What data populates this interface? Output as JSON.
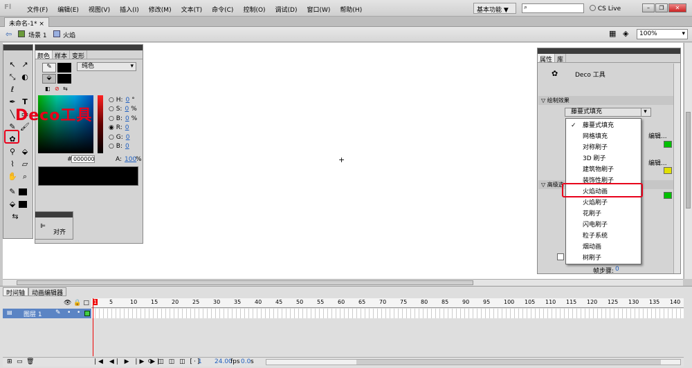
{
  "app": {
    "logo": "Fl"
  },
  "menu": [
    "文件(F)",
    "编辑(E)",
    "视图(V)",
    "插入(I)",
    "修改(M)",
    "文本(T)",
    "命令(C)",
    "控制(O)",
    "调试(D)",
    "窗口(W)",
    "帮助(H)"
  ],
  "workspace": {
    "label": "基本功能",
    "arrow": "▼"
  },
  "search": {
    "placeholder": ""
  },
  "cslive": "CS Live",
  "doc_tab": "未命名-1*",
  "breadcrumb": {
    "scene": "场景 1",
    "symbol": "火焰"
  },
  "zoom": "100%",
  "annotation": "Deco工具",
  "color_panel": {
    "tabs": [
      "颜色",
      "样本",
      "变形"
    ],
    "fill_type": "纯色",
    "fields": [
      {
        "label": "H:",
        "value": "0",
        "unit": "°"
      },
      {
        "label": "S:",
        "value": "0",
        "unit": "%"
      },
      {
        "label": "B:",
        "value": "0",
        "unit": "%"
      },
      {
        "label": "R:",
        "value": "0",
        "unit": ""
      },
      {
        "label": "G:",
        "value": "0",
        "unit": ""
      },
      {
        "label": "B:",
        "value": "0",
        "unit": ""
      }
    ],
    "alpha_label": "A:",
    "alpha_value": "100",
    "alpha_unit": "%",
    "hex_prefix": "#",
    "hex": "000000"
  },
  "align_panel": {
    "label": "对齐"
  },
  "properties": {
    "tabs": [
      "属性",
      "库"
    ],
    "tool_name": "Deco 工具",
    "section_draw": "绘制效果",
    "dropdown_value": "藤蔓式填充",
    "section_adv": "高级选",
    "edit1": "编辑...",
    "edit2": "编辑...",
    "frame_step_label": "帧步骤:",
    "frame_step_value": "0"
  },
  "effect_menu": {
    "items": [
      "藤蔓式填充",
      "网格填充",
      "对称刷子",
      "3D 刷子",
      "建筑物刷子",
      "装饰性刷子",
      "火焰动画",
      "火焰刷子",
      "花刷子",
      "闪电刷子",
      "粒子系统",
      "烟动画",
      "树刷子"
    ],
    "checked_index": 0,
    "highlighted_index": 6
  },
  "timeline": {
    "tabs": [
      "时间轴",
      "动画编辑器"
    ],
    "layer": "图层 1",
    "ruler": [
      "1",
      "5",
      "10",
      "15",
      "20",
      "25",
      "30",
      "35",
      "40",
      "45",
      "50",
      "55",
      "60",
      "65",
      "70",
      "75",
      "80",
      "85",
      "90",
      "95",
      "100",
      "105",
      "110",
      "115",
      "120",
      "125",
      "130",
      "135",
      "140"
    ],
    "current_frame": "1",
    "fps": "24.00",
    "fps_unit": "fps",
    "time": "0.0",
    "time_unit": "s"
  },
  "colors": {
    "annotation": "#e8001a",
    "layer_selected": "#5b84c4",
    "link": "#1f5fbf"
  }
}
